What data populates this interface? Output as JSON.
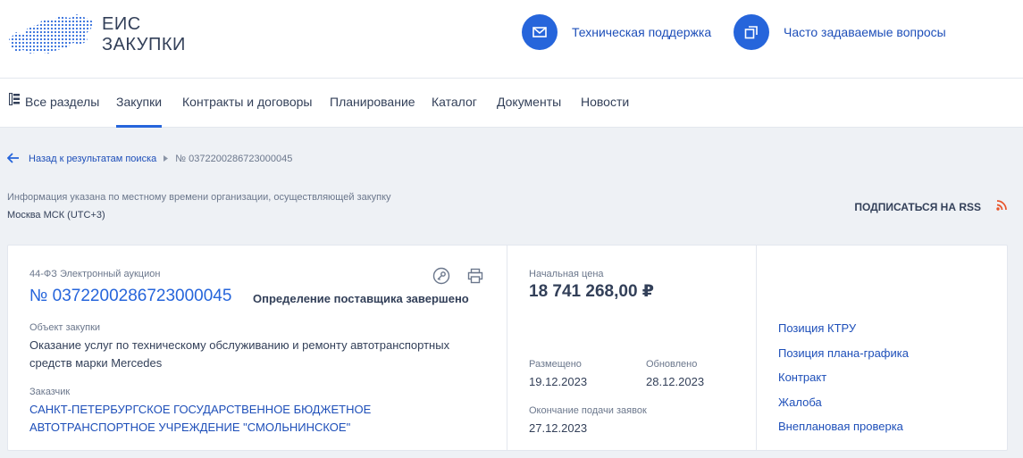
{
  "header": {
    "logo_line1": "ЕИС",
    "logo_line2": "ЗАКУПКИ",
    "support_label": "Техническая поддержка",
    "faq_label": "Часто задаваемые вопросы",
    "accent_color": "#2665db"
  },
  "nav": {
    "items": [
      {
        "label": "Все разделы",
        "icon": "sections-icon"
      },
      {
        "label": "Закупки",
        "active": true
      },
      {
        "label": "Контракты и договоры"
      },
      {
        "label": "Планирование"
      },
      {
        "label": "Каталог"
      },
      {
        "label": "Документы"
      },
      {
        "label": "Новости"
      }
    ]
  },
  "breadcrumb": {
    "back_label": "Назад к результатам поиска",
    "current": "№ 0372200286723000045"
  },
  "info": {
    "note": "Информация указана по местному времени организации, осуществляющей закупку",
    "timezone": "Москва МСК (UTC+3)",
    "rss_label": "ПОДПИСАТЬСЯ НА RSS"
  },
  "purchase": {
    "regulation": "44-ФЗ Электронный аукцион",
    "number": "№ 0372200286723000045",
    "status": "Определение поставщика завершено",
    "object_label": "Объект закупки",
    "object_value": "Оказание услуг по техническому обслуживанию и ремонту автотранспортных средств марки Mercedes",
    "customer_label": "Заказчик",
    "customer_value": "САНКТ-ПЕТЕРБУРГСКОЕ ГОСУДАРСТВЕННОЕ БЮДЖЕТНОЕ АВТОТРАНСПОРТНОЕ УЧРЕЖДЕНИЕ \"СМОЛЬНИНСКОЕ\"",
    "price_label": "Начальная цена",
    "price_value": "18 741 268,00 ₽",
    "published_label": "Размещено",
    "published_value": "19.12.2023",
    "updated_label": "Обновлено",
    "updated_value": "28.12.2023",
    "deadline_label": "Окончание подачи заявок",
    "deadline_value": "27.12.2023"
  },
  "links": [
    "Позиция КТРУ",
    "Позиция плана-графика",
    "Контракт",
    "Жалоба",
    "Внеплановая проверка"
  ]
}
